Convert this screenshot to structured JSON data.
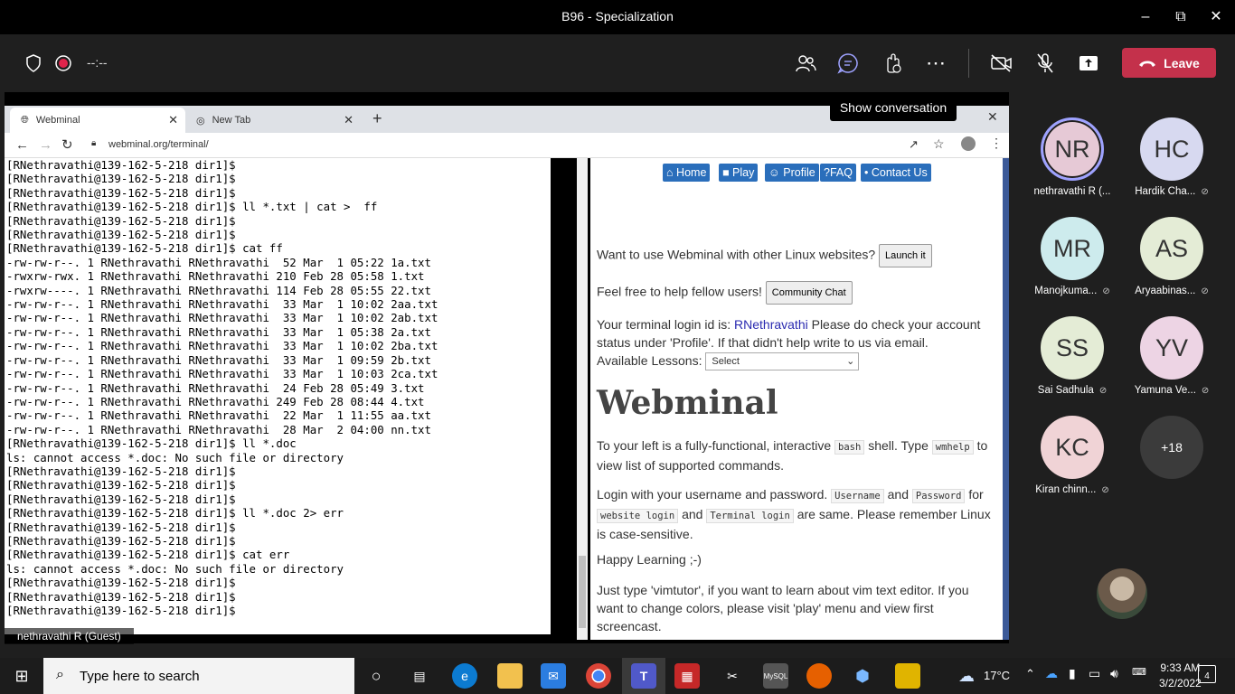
{
  "window": {
    "title": "B96 - Specialization"
  },
  "meeting": {
    "timer": "--:--",
    "tooltip": "Show conversation",
    "leave_label": "Leave"
  },
  "browser": {
    "tabs": [
      {
        "label": "Webminal"
      },
      {
        "label": "New Tab"
      }
    ],
    "url": "webminal.org/terminal/"
  },
  "terminal": {
    "lines": [
      "[RNethravathi@139-162-5-218 dir1]$",
      "[RNethravathi@139-162-5-218 dir1]$",
      "[RNethravathi@139-162-5-218 dir1]$",
      "[RNethravathi@139-162-5-218 dir1]$ ll *.txt | cat >  ff",
      "[RNethravathi@139-162-5-218 dir1]$",
      "[RNethravathi@139-162-5-218 dir1]$",
      "[RNethravathi@139-162-5-218 dir1]$ cat ff",
      "-rw-rw-r--. 1 RNethravathi RNethravathi  52 Mar  1 05:22 1a.txt",
      "-rwxrw-rwx. 1 RNethravathi RNethravathi 210 Feb 28 05:58 1.txt",
      "-rwxrw----. 1 RNethravathi RNethravathi 114 Feb 28 05:55 22.txt",
      "-rw-rw-r--. 1 RNethravathi RNethravathi  33 Mar  1 10:02 2aa.txt",
      "-rw-rw-r--. 1 RNethravathi RNethravathi  33 Mar  1 10:02 2ab.txt",
      "-rw-rw-r--. 1 RNethravathi RNethravathi  33 Mar  1 05:38 2a.txt",
      "-rw-rw-r--. 1 RNethravathi RNethravathi  33 Mar  1 10:02 2ba.txt",
      "-rw-rw-r--. 1 RNethravathi RNethravathi  33 Mar  1 09:59 2b.txt",
      "-rw-rw-r--. 1 RNethravathi RNethravathi  33 Mar  1 10:03 2ca.txt",
      "-rw-rw-r--. 1 RNethravathi RNethravathi  24 Feb 28 05:49 3.txt",
      "-rw-rw-r--. 1 RNethravathi RNethravathi 249 Feb 28 08:44 4.txt",
      "-rw-rw-r--. 1 RNethravathi RNethravathi  22 Mar  1 11:55 aa.txt",
      "-rw-rw-r--. 1 RNethravathi RNethravathi  28 Mar  2 04:00 nn.txt",
      "[RNethravathi@139-162-5-218 dir1]$ ll *.doc",
      "ls: cannot access *.doc: No such file or directory",
      "[RNethravathi@139-162-5-218 dir1]$",
      "[RNethravathi@139-162-5-218 dir1]$",
      "[RNethravathi@139-162-5-218 dir1]$",
      "[RNethravathi@139-162-5-218 dir1]$ ll *.doc 2> err",
      "[RNethravathi@139-162-5-218 dir1]$",
      "[RNethravathi@139-162-5-218 dir1]$",
      "[RNethravathi@139-162-5-218 dir1]$ cat err",
      "ls: cannot access *.doc: No such file or directory",
      "[RNethravathi@139-162-5-218 dir1]$",
      "[RNethravathi@139-162-5-218 dir1]$",
      "[RNethravathi@139-162-5-218 dir1]$"
    ]
  },
  "webminal": {
    "nav": [
      "Home",
      "Play",
      "Profile",
      "FAQ",
      "Contact Us"
    ],
    "other_sites_text": "Want to use Webminal with other Linux websites?",
    "launch_label": "Launch it",
    "help_text": "Feel free to help fellow users!",
    "community_label": "Community Chat",
    "login_prefix": "Your terminal login id is:",
    "login_id": "RNethravathi",
    "login_suffix": "Please do check your account status under 'Profile'. If that didn't help write to us via email.",
    "lessons_label": "Available Lessons:",
    "lessons_selected": "Select",
    "heading": "Webminal",
    "p1_a": "To your left is a fully-functional, interactive",
    "p1_code1": "bash",
    "p1_b": "shell. Type",
    "p1_code2": "wmhelp",
    "p1_c": "to view list of supported commands.",
    "p2_a": "Login with your username and password.",
    "p2_code1": "Username",
    "p2_b": "and",
    "p2_code2": "Password",
    "p2_c": "for",
    "p2_code3": "website login",
    "p2_d": "and",
    "p2_code4": "Terminal login",
    "p2_e": "are same. Please remember Linux is case-sensitive.",
    "p3": "Happy Learning ;-)",
    "p4": "Just type 'vimtutor', if you want to learn about vim text editor. If you want to change colors, please visit 'play' menu and view first screencast."
  },
  "presenter_label": "nethravathi R (Guest)",
  "participants": [
    {
      "initials": "NR",
      "name": "nethravathi R (...",
      "color": "#e6c9d6",
      "muted": false,
      "active": true
    },
    {
      "initials": "HC",
      "name": "Hardik Cha...",
      "color": "#d7d9f0",
      "muted": true
    },
    {
      "initials": "MR",
      "name": "Manojkuma...",
      "color": "#cdebed",
      "muted": true
    },
    {
      "initials": "AS",
      "name": "Aryaabinas...",
      "color": "#e4ecd6",
      "muted": true
    },
    {
      "initials": "SS",
      "name": "Sai Sadhula",
      "color": "#e4ecd6",
      "muted": true
    },
    {
      "initials": "YV",
      "name": "Yamuna Ve...",
      "color": "#edd4e4",
      "muted": true
    },
    {
      "initials": "KC",
      "name": "Kiran chinn...",
      "color": "#f0d3d6",
      "muted": true
    }
  ],
  "overflow_count": "+18",
  "taskbar": {
    "search_placeholder": "Type here to search",
    "weather": "17°C",
    "time": "9:33 AM",
    "date": "3/2/2022",
    "notifications": "4"
  }
}
